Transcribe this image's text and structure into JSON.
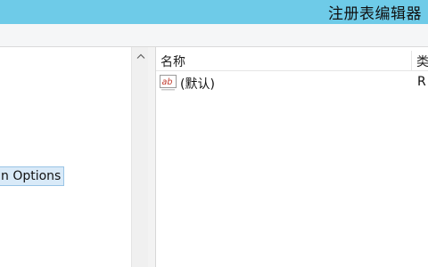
{
  "window": {
    "title": "注册表编辑器"
  },
  "tree": {
    "selected_item_label": "n Options"
  },
  "list": {
    "columns": {
      "name": "名称",
      "type": "类"
    },
    "rows": [
      {
        "icon": "string-value-icon",
        "icon_text": "ab",
        "name": "(默认)",
        "type": "R"
      }
    ]
  },
  "colors": {
    "titlebar": "#6ecbe8",
    "selection_fill": "#d9eaf8",
    "selection_border": "#99c4e6"
  }
}
